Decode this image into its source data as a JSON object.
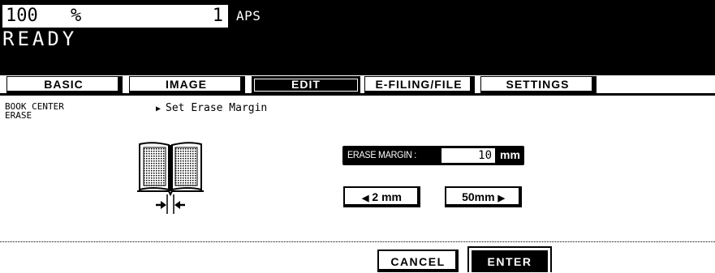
{
  "status": {
    "zoom_value": "100",
    "zoom_unit": "%",
    "copy_count": "1",
    "paper_mode": "APS",
    "machine_state": "READY"
  },
  "tabs": [
    {
      "label": "BASIC"
    },
    {
      "label": "IMAGE"
    },
    {
      "label": "EDIT",
      "active": true
    },
    {
      "label": "E-FILING/FILE"
    },
    {
      "label": "SETTINGS"
    }
  ],
  "breadcrumb": {
    "function_line1": "BOOK CENTER",
    "function_line2": "ERASE",
    "instruction": "Set Erase Margin"
  },
  "erase_margin": {
    "label": "ERASE MARGIN :",
    "value": "10",
    "unit": "mm",
    "min_button": "2 mm",
    "max_button": "50mm"
  },
  "footer": {
    "cancel_label": "CANCEL",
    "enter_label": "ENTER"
  },
  "icons": {
    "tab_marker": "triangle-right",
    "book": "open-book-icon",
    "center_arrows": "inward-arrows-icon"
  }
}
